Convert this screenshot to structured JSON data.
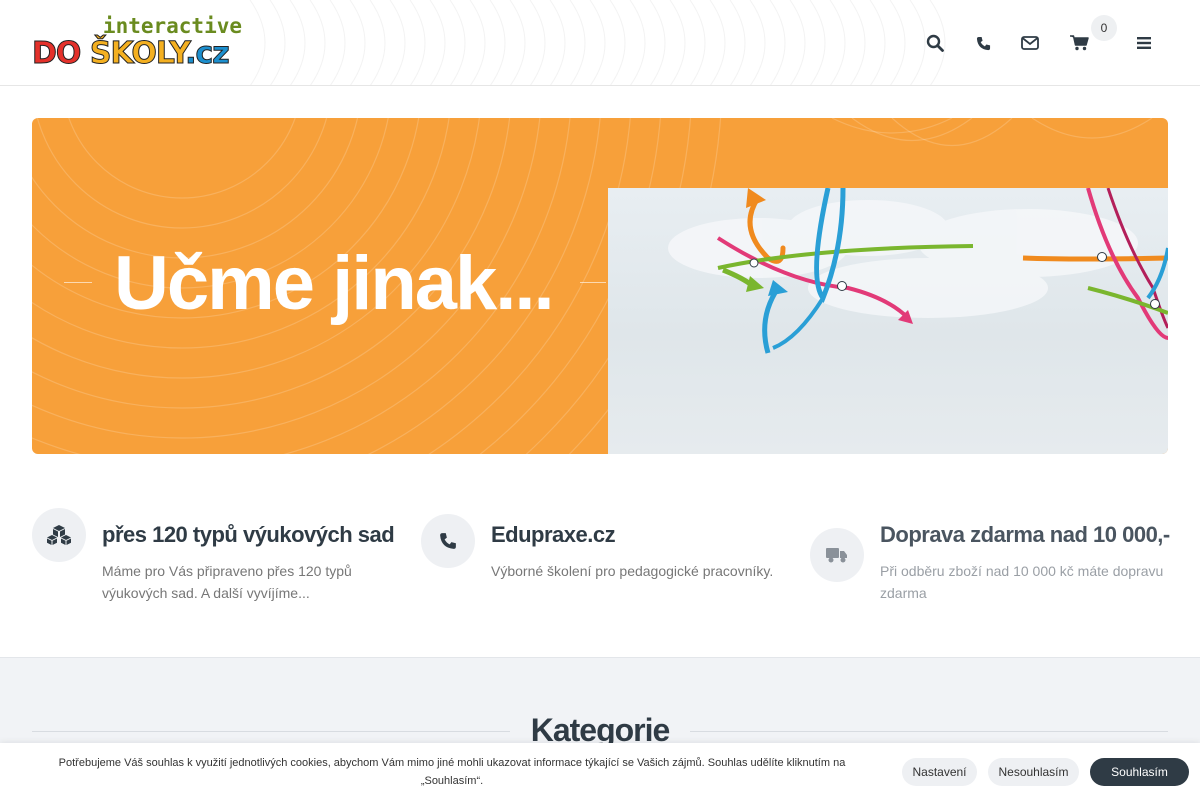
{
  "header": {
    "logo_top": "interactive",
    "logo_bottom": {
      "part1": "DO ",
      "part2": "ŠKOLY",
      "part3": ".cz"
    },
    "icons": [
      "search-icon",
      "phone-icon",
      "envelope-icon",
      "cart-icon",
      "menu-icon"
    ],
    "cart_count": "0"
  },
  "hero": {
    "title": "Učme jinak...",
    "background_color": "#f7a03a"
  },
  "features": [
    {
      "icon": "cubes-icon",
      "title": "přes 120 typů výukových sad",
      "description": "Máme pro Vás připraveno přes 120 typů výukových sad. A další vyvíjíme..."
    },
    {
      "icon": "phone-icon",
      "title": "Edupraxe.cz",
      "description": "Výborné školení pro pedagogické pracovníky."
    },
    {
      "icon": "truck-icon",
      "title": "Doprava zdarma nad 10 000,-",
      "description": "Při odběru zboží nad 10 000 kč máte dopravu zdarma"
    }
  ],
  "categories": {
    "title": "Kategorie"
  },
  "cookie": {
    "text": "Potřebujeme Váš souhlas k využití jednotlivých cookies, abychom Vám mimo jiné mohli ukazovat informace týkající se Vašich zájmů. Souhlas udělíte kliknutím na „Souhlasím“.",
    "settings_label": "Nastavení",
    "decline_label": "Nesouhlasím",
    "accept_label": "Souhlasím"
  },
  "colors": {
    "accent_orange": "#f7a03a",
    "dark": "#2f3b45",
    "logo_green": "#6a8b1f"
  }
}
